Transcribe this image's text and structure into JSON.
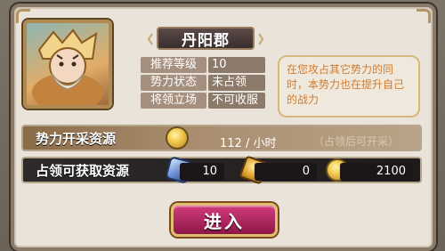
{
  "territory": {
    "name": "丹阳郡",
    "stats": [
      {
        "label": "推荐等级",
        "value": "10"
      },
      {
        "label": "势力状态",
        "value": "未占领"
      },
      {
        "label": "将领立场",
        "value": "不可收服"
      }
    ],
    "description": "在您攻占其它势力的同时，本势力也在提升自己的战力"
  },
  "income": {
    "title": "势力开采资源",
    "amount": "112 / 小时",
    "note": "（占领后可开采）"
  },
  "rewards": {
    "title": "占领可获取资源",
    "items": [
      {
        "icon": "gem-icon",
        "value": "10"
      },
      {
        "icon": "token-icon",
        "value": "0"
      },
      {
        "icon": "gold-coin-icon",
        "value": "2100"
      }
    ]
  },
  "actions": {
    "enter_label": "进入"
  }
}
